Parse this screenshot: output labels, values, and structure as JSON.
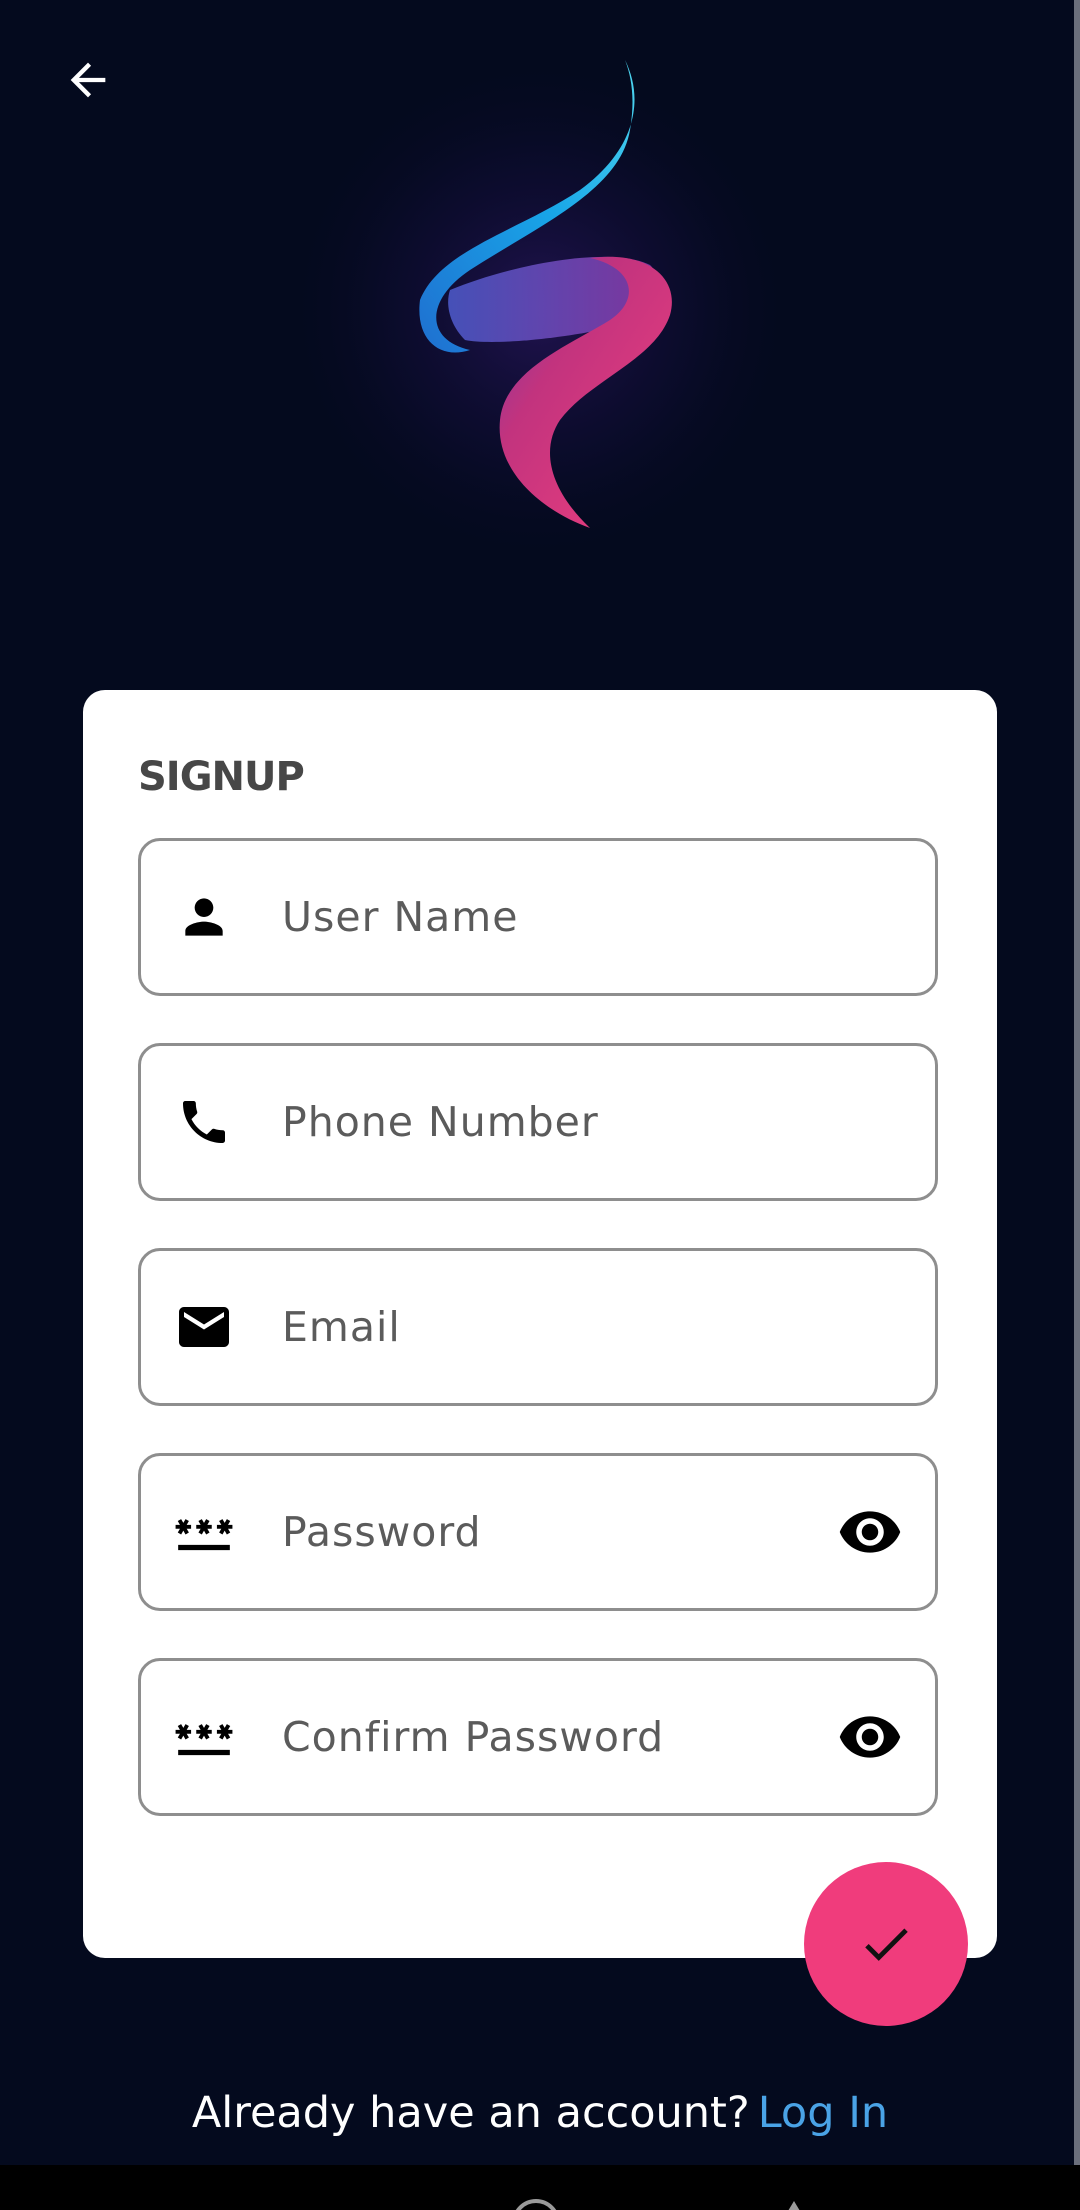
{
  "colors": {
    "background": "#040a1e",
    "card": "#ffffff",
    "accent": "#f03c7c",
    "link": "#4aa3e6",
    "title": "#474747",
    "placeholder": "#5b5b5b",
    "field_border": "#8e8e8e"
  },
  "header": {
    "back_icon": "arrow-left-icon",
    "logo": "app-logo-ribbon"
  },
  "signup": {
    "title": "SIGNUP",
    "fields": [
      {
        "icon": "person-icon",
        "placeholder": "User Name",
        "value": ""
      },
      {
        "icon": "phone-icon",
        "placeholder": "Phone Number",
        "value": ""
      },
      {
        "icon": "mail-icon",
        "placeholder": "Email",
        "value": ""
      },
      {
        "icon": "password-icon",
        "placeholder": "Password",
        "value": "",
        "trailing_icon": "eye-icon"
      },
      {
        "icon": "password-icon",
        "placeholder": "Confirm Password",
        "value": "",
        "trailing_icon": "eye-icon"
      }
    ],
    "submit_icon": "check-icon"
  },
  "footer": {
    "prompt": "Already have an account?",
    "link": "Log In"
  }
}
